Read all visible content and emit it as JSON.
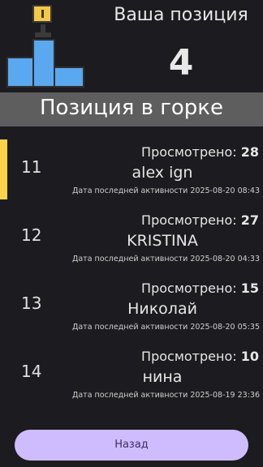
{
  "header": {
    "position_title": "Ваша позиция",
    "position_value": "4"
  },
  "banner": {
    "title": "Позиция в горке"
  },
  "rows": [
    {
      "rank": "11",
      "viewed_label": "Просмотрено: ",
      "viewed_count": "28",
      "name": "alex ign",
      "activity": "Дата последней активности 2025-08-20 08:43",
      "highlighted": true
    },
    {
      "rank": "12",
      "viewed_label": "Просмотрено: ",
      "viewed_count": "27",
      "name": "KRISTINA",
      "activity": "Дата последней активности 2025-08-20 04:33",
      "highlighted": false
    },
    {
      "rank": "13",
      "viewed_label": "Просмотрено: ",
      "viewed_count": "15",
      "name": "Николай",
      "activity": "Дата последней активности 2025-08-20 05:35",
      "highlighted": false
    },
    {
      "rank": "14",
      "viewed_label": "Просмотрено: ",
      "viewed_count": "10",
      "name": "нина",
      "activity": "Дата последней активности 2025-08-19 23:36",
      "highlighted": false
    }
  ],
  "back_button": {
    "label": "Назад"
  },
  "icons": {
    "podium": "podium-icon",
    "medal": "medal-icon"
  },
  "colors": {
    "background": "#1c1b1f",
    "banner": "#5e5e5e",
    "accent": "#fbd34a",
    "podium_blue": "#5aa8ef",
    "button": "#cfbcff"
  }
}
